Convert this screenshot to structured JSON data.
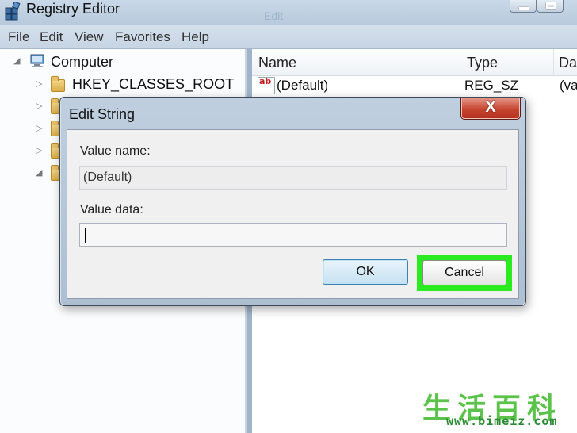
{
  "window": {
    "title": "Registry Editor",
    "ghost_title": "Edit"
  },
  "menu": [
    "File",
    "Edit",
    "View",
    "Favorites",
    "Help"
  ],
  "tree": {
    "root": "Computer",
    "items": [
      "HKEY_CLASSES_ROOT"
    ]
  },
  "list": {
    "headers": [
      "Name",
      "Type",
      "Da"
    ],
    "rows": [
      {
        "name": "(Default)",
        "type": "REG_SZ",
        "data": "(va"
      }
    ]
  },
  "dialog": {
    "title": "Edit String",
    "close_glyph": "X",
    "value_name_label": "Value name:",
    "value_name": "(Default)",
    "value_data_label": "Value data:",
    "value_data": "",
    "ok_label": "OK",
    "cancel_label": "Cancel"
  },
  "colors": {
    "highlight": "#2bea1f",
    "close_button": "#c6452f"
  },
  "watermark": {
    "text_cn": "生活百科",
    "url": "www.bimeiz.com"
  }
}
